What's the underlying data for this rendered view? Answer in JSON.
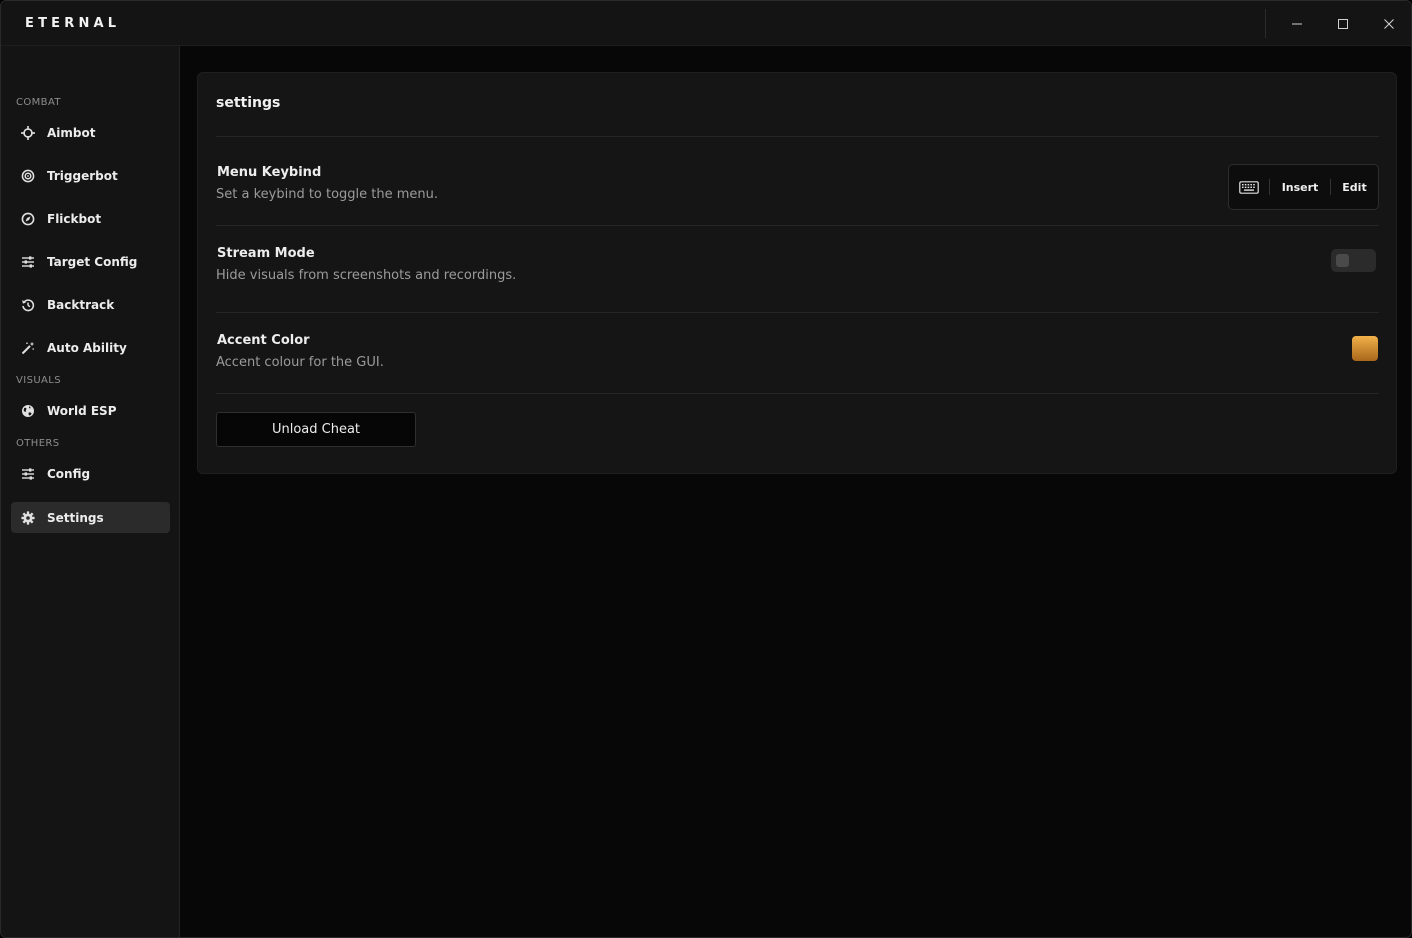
{
  "app": {
    "brand": "ETERNAL"
  },
  "titlebar": {
    "buttons": [
      {
        "name": "minimize",
        "icon": "minimize-icon"
      },
      {
        "name": "maximize",
        "icon": "maximize-icon"
      },
      {
        "name": "close",
        "icon": "close-icon"
      }
    ]
  },
  "sidebar": {
    "sections": {
      "combat": "COMBAT",
      "visuals": "VISUALS",
      "others": "OTHERS"
    },
    "items": [
      {
        "label": "Aimbot",
        "icon": "crosshair-icon"
      },
      {
        "label": "Triggerbot",
        "icon": "target-icon"
      },
      {
        "label": "Flickbot",
        "icon": "compass-icon"
      },
      {
        "label": "Target Config",
        "icon": "sliders-icon"
      },
      {
        "label": "Backtrack",
        "icon": "history-icon"
      },
      {
        "label": "Auto Ability",
        "icon": "magic-wand-icon"
      },
      {
        "label": "World ESP",
        "icon": "globe-icon"
      },
      {
        "label": "Config",
        "icon": "sliders-icon"
      },
      {
        "label": "Settings",
        "icon": "gear-icon",
        "active": true
      }
    ]
  },
  "panel": {
    "title": "settings",
    "menu_keybind": {
      "title": "Menu Keybind",
      "description": "Set a keybind to toggle the menu.",
      "key": "Insert",
      "edit_label": "Edit",
      "icon": "keyboard-icon"
    },
    "stream_mode": {
      "title": "Stream Mode",
      "description": "Hide visuals from screenshots and recordings.",
      "enabled": false
    },
    "accent_color": {
      "title": "Accent Color",
      "description": "Accent colour for the GUI.",
      "color_top": "#f2b24a",
      "color_bottom": "#a8661a"
    },
    "unload_label": "Unload Cheat"
  }
}
